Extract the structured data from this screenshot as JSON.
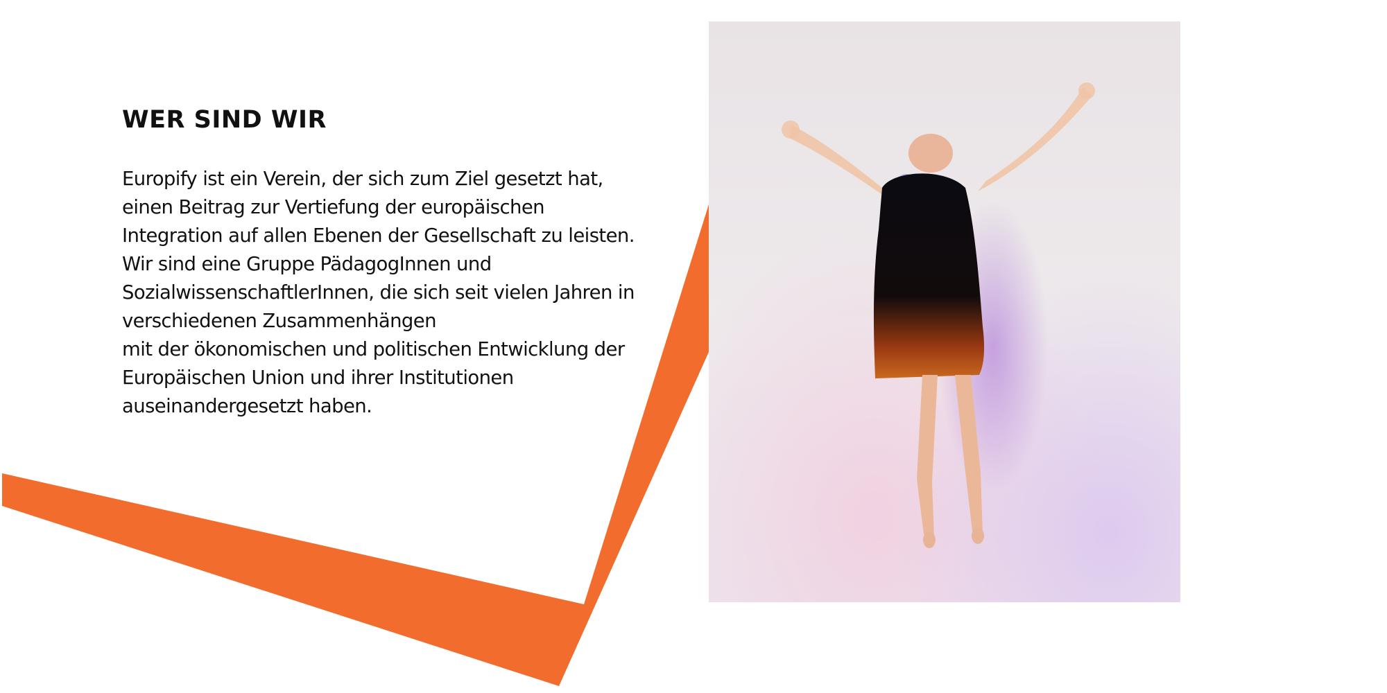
{
  "section": {
    "heading": "WER SIND WIR",
    "lines": [
      "Europify ist ein Verein, der sich zum Ziel gesetzt hat,",
      "einen Beitrag zur Vertiefung der europäischen",
      "Integration auf allen Ebenen der Gesellschaft zu leisten.",
      "Wir sind eine Gruppe PädagogInnen und",
      "SozialwissenschaftlerInnen, die sich seit vielen Jahren in",
      "verschiedenen Zusammenhängen",
      "mit der ökonomischen und politischen Entwicklung der",
      "Europäischen Union und ihrer Institutionen",
      "auseinandergesetzt haben."
    ]
  },
  "colors": {
    "accent": "#f26d2d",
    "text": "#111111",
    "background": "#ffffff"
  }
}
